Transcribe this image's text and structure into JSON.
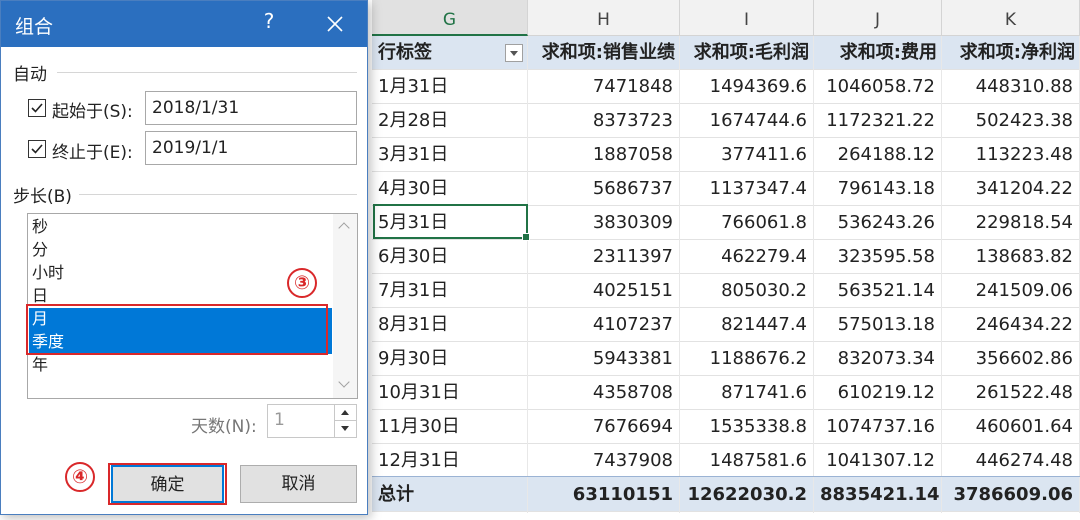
{
  "colors": {
    "title_bar": "#2b6fbf",
    "selection": "#0078d7",
    "annotation": "#d9282a",
    "pivot_header": "#dbe5f1",
    "cell_cursor": "#217346"
  },
  "dialog": {
    "title": "组合",
    "help_label": "?",
    "close_icon": "close-icon",
    "auto_section": "自动",
    "start_label": "起始于(S):",
    "start_checked": true,
    "start_value": "2018/1/31",
    "end_label": "终止于(E):",
    "end_checked": true,
    "end_value": "2019/1/1",
    "step_section": "步长(B)",
    "step_items": [
      {
        "label": "秒",
        "selected": false
      },
      {
        "label": "分",
        "selected": false
      },
      {
        "label": "小时",
        "selected": false
      },
      {
        "label": "日",
        "selected": false
      },
      {
        "label": "月",
        "selected": true
      },
      {
        "label": "季度",
        "selected": true
      },
      {
        "label": "年",
        "selected": false
      }
    ],
    "days_label": "天数(N):",
    "days_value": "1",
    "ok_label": "确定",
    "cancel_label": "取消"
  },
  "annotations": {
    "step3": "③",
    "step4": "④"
  },
  "sheet": {
    "columns": [
      "G",
      "H",
      "I",
      "J",
      "K"
    ],
    "active_column": "G",
    "header": {
      "row_label": "行标签",
      "sales": "求和项:销售业绩",
      "gross": "求和项:毛利润",
      "cost": "求和项:费用",
      "net": "求和项:净利润"
    },
    "rows": [
      {
        "label": "1月31日",
        "sales": "7471848",
        "gross": "1494369.6",
        "cost": "1046058.72",
        "net": "448310.88"
      },
      {
        "label": "2月28日",
        "sales": "8373723",
        "gross": "1674744.6",
        "cost": "1172321.22",
        "net": "502423.38"
      },
      {
        "label": "3月31日",
        "sales": "1887058",
        "gross": "377411.6",
        "cost": "264188.12",
        "net": "113223.48"
      },
      {
        "label": "4月30日",
        "sales": "5686737",
        "gross": "1137347.4",
        "cost": "796143.18",
        "net": "341204.22"
      },
      {
        "label": "5月31日",
        "sales": "3830309",
        "gross": "766061.8",
        "cost": "536243.26",
        "net": "229818.54"
      },
      {
        "label": "6月30日",
        "sales": "2311397",
        "gross": "462279.4",
        "cost": "323595.58",
        "net": "138683.82"
      },
      {
        "label": "7月31日",
        "sales": "4025151",
        "gross": "805030.2",
        "cost": "563521.14",
        "net": "241509.06"
      },
      {
        "label": "8月31日",
        "sales": "4107237",
        "gross": "821447.4",
        "cost": "575013.18",
        "net": "246434.22"
      },
      {
        "label": "9月30日",
        "sales": "5943381",
        "gross": "1188676.2",
        "cost": "832073.34",
        "net": "356602.86"
      },
      {
        "label": "10月31日",
        "sales": "4358708",
        "gross": "871741.6",
        "cost": "610219.12",
        "net": "261522.48"
      },
      {
        "label": "11月30日",
        "sales": "7676694",
        "gross": "1535338.8",
        "cost": "1074737.16",
        "net": "460601.64"
      },
      {
        "label": "12月31日",
        "sales": "7437908",
        "gross": "1487581.6",
        "cost": "1041307.12",
        "net": "446274.48"
      }
    ],
    "total": {
      "label": "总计",
      "sales": "63110151",
      "gross": "12622030.2",
      "cost": "8835421.14",
      "net": "3786609.06"
    }
  }
}
